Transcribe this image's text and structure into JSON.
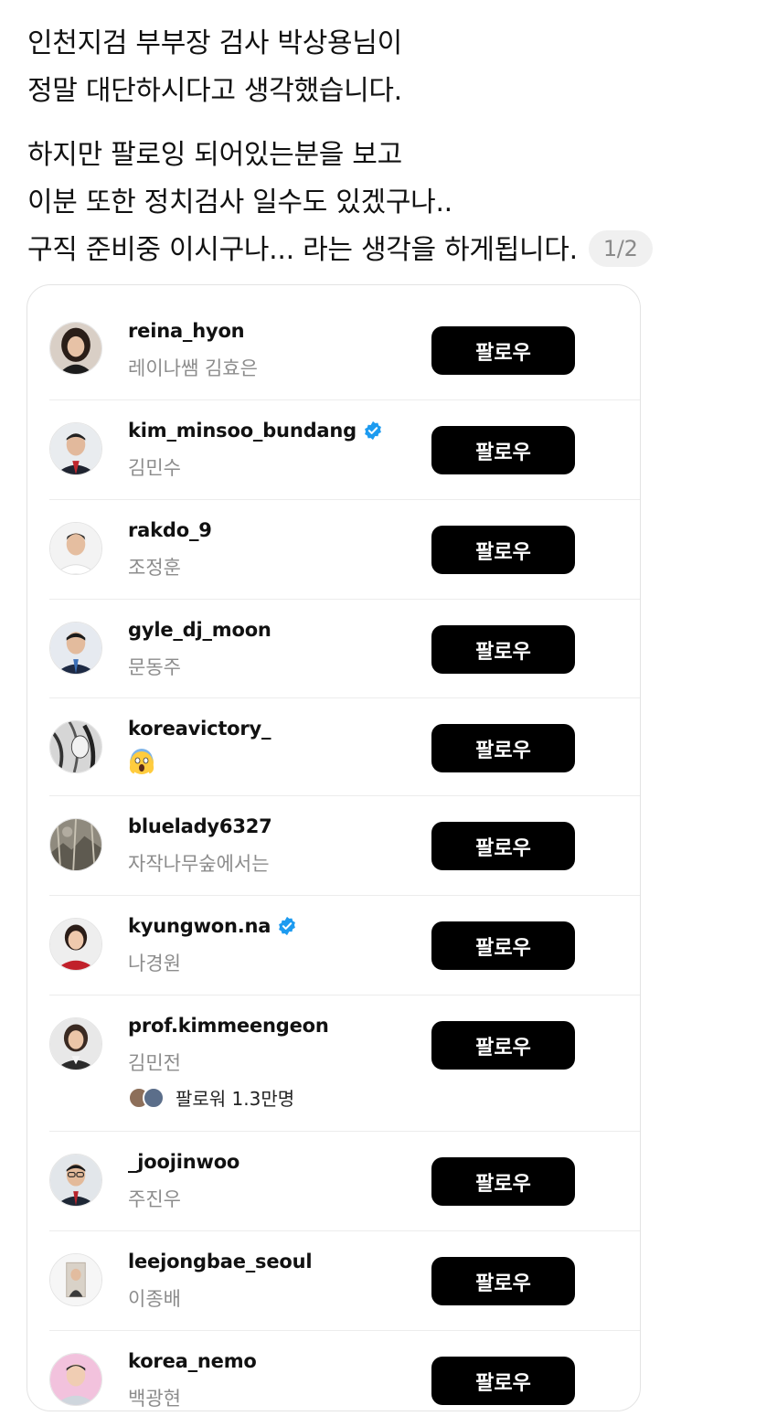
{
  "post": {
    "paragraphs": [
      [
        "인천지검 부부장 검사 박상용님이",
        "정말 대단하시다고 생각했습니다."
      ],
      [
        "하지만 팔로잉 되어있는분을 보고",
        "이분 또한 정치검사 일수도 있겠구나..",
        "구직 준비중 이시구나... 라는 생각을 하게됩니다."
      ]
    ],
    "page_indicator": "1/2"
  },
  "follow_label": "팔로우",
  "accounts": [
    {
      "username": "reina_hyon",
      "name": "레이나쌤 김효은",
      "verified": false,
      "avatar": "female-portrait-dark-hair"
    },
    {
      "username": "kim_minsoo_bundang",
      "name": "김민수",
      "verified": true,
      "avatar": "male-suit-red-tie"
    },
    {
      "username": "rakdo_9",
      "name": "조정훈",
      "verified": false,
      "avatar": "male-white-shirt"
    },
    {
      "username": "gyle_dj_moon",
      "name": "문동주",
      "verified": false,
      "avatar": "male-suit-blue-tie"
    },
    {
      "username": "koreavictory_",
      "name": "",
      "emoji": "face-screaming-in-fear",
      "verified": false,
      "avatar": "manga-sketch"
    },
    {
      "username": "bluelady6327",
      "name": "자작나무숲에서는",
      "verified": false,
      "avatar": "sepia-landscape"
    },
    {
      "username": "kyungwon.na",
      "name": "나경원",
      "verified": true,
      "avatar": "female-red-jacket"
    },
    {
      "username": "prof.kimmeengeon",
      "name": "김민전",
      "verified": false,
      "avatar": "female-dark-jacket",
      "followed_by": "팔로워 1.3만명"
    },
    {
      "username": "_joojinwoo",
      "name": "주진우",
      "verified": false,
      "avatar": "male-glasses-suit"
    },
    {
      "username": "leejongbae_seoul",
      "name": "이종배",
      "verified": false,
      "avatar": "male-portrait-frame"
    },
    {
      "username": "korea_nemo",
      "name": "백광현",
      "verified": false,
      "avatar": "male-pink-background"
    }
  ],
  "colors": {
    "button": "#000000",
    "button_text": "#ffffff",
    "verified": "#1d9bf0",
    "secondary_text": "#8c8c8c",
    "pill_bg": "#f0f0f0"
  }
}
